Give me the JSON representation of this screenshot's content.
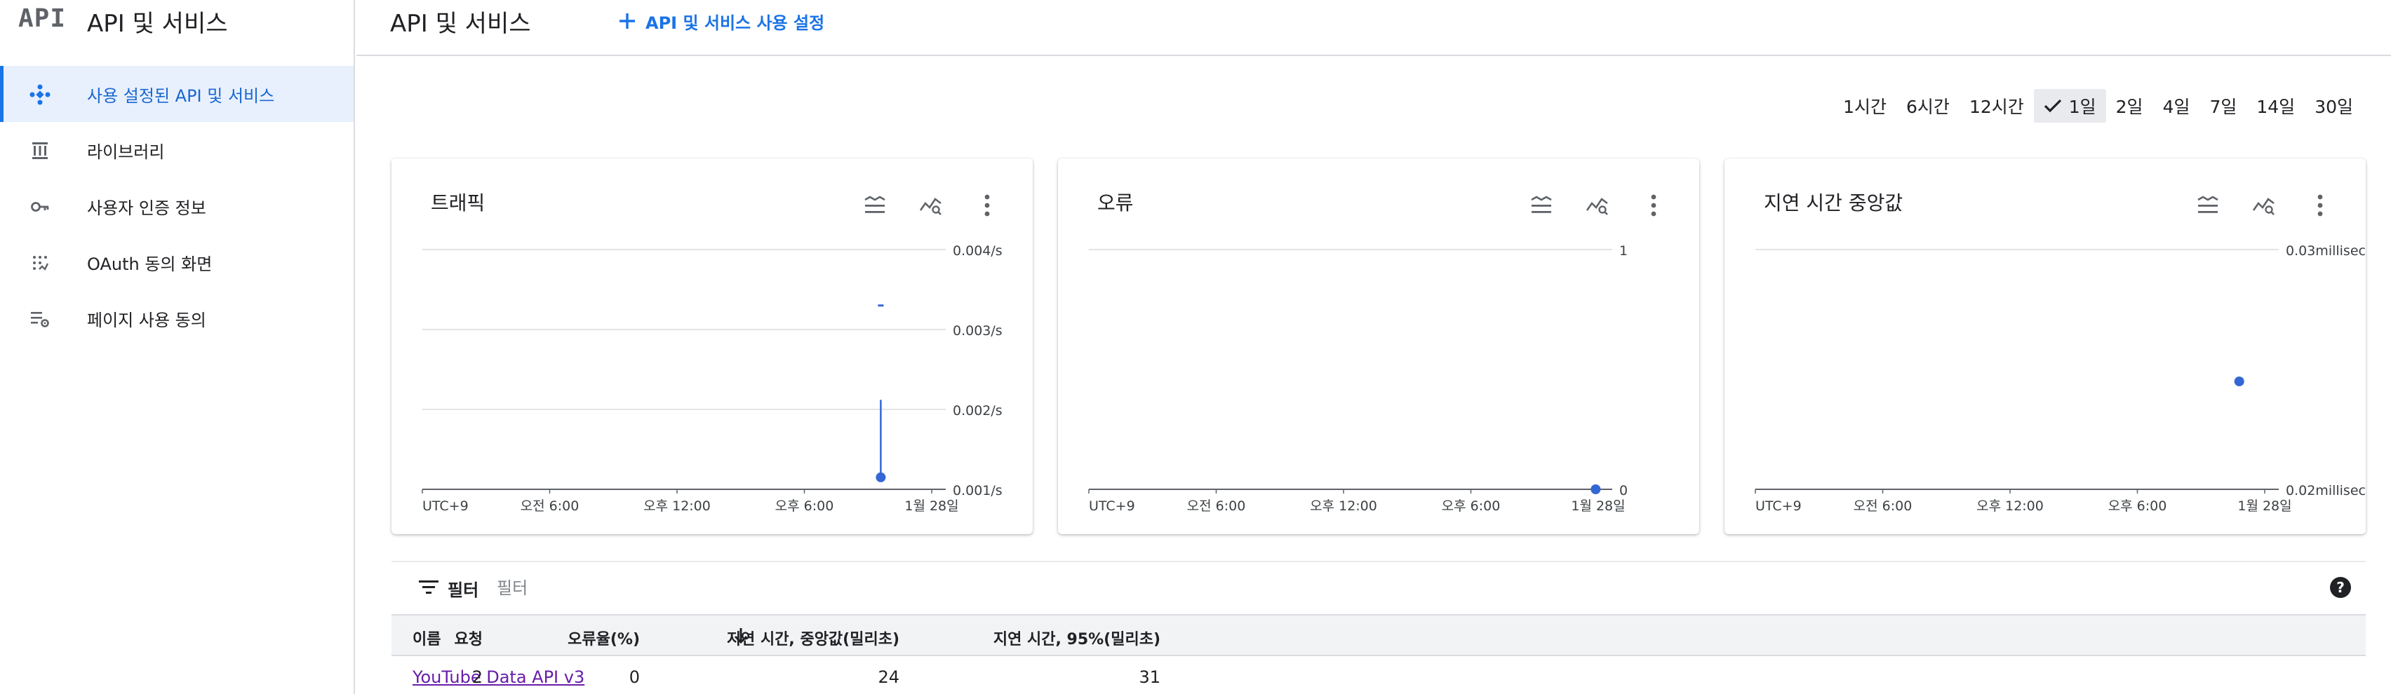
{
  "brand": {
    "logo": "API",
    "title": "API 및 서비스"
  },
  "sidebar": {
    "items": [
      {
        "label": "사용 설정된 API 및 서비스",
        "icon": "api-diamond-icon",
        "active": true
      },
      {
        "label": "라이브러리",
        "icon": "library-icon",
        "active": false
      },
      {
        "label": "사용자 인증 정보",
        "icon": "key-icon",
        "active": false
      },
      {
        "label": "OAuth 동의 화면",
        "icon": "oauth-consent-icon",
        "active": false
      },
      {
        "label": "페이지 사용 동의",
        "icon": "page-settings-icon",
        "active": false
      }
    ]
  },
  "header": {
    "title": "API 및 서비스",
    "enable_button": "API 및 서비스 사용 설정"
  },
  "time_range": {
    "options": [
      "1시간",
      "6시간",
      "12시간",
      "1일",
      "2일",
      "4일",
      "7일",
      "14일",
      "30일"
    ],
    "selected": "1일"
  },
  "colors": {
    "accent": "#1a73e8",
    "series": "#3367d6",
    "link": "#681da8",
    "active_bg": "#e8f0fe"
  },
  "chart_data": [
    {
      "type": "line",
      "title": "트래픽",
      "x_ticks": [
        "UTC+9",
        "오전 6:00",
        "오후 12:00",
        "오후 6:00",
        "1월 28일"
      ],
      "y_ticks": [
        "0.004/s",
        "0.003/s",
        "0.002/s",
        "0.001/s"
      ],
      "ylim": [
        0.001,
        0.004
      ],
      "points": [
        {
          "x": 0.9,
          "y": 0.0033
        },
        {
          "x": 0.9,
          "y": 0.00212
        },
        {
          "x": 0.9,
          "y": 0.00115
        }
      ],
      "marker_at_last": true
    },
    {
      "type": "scatter",
      "title": "오류",
      "x_ticks": [
        "UTC+9",
        "오전 6:00",
        "오후 12:00",
        "오후 6:00",
        "1월 28일"
      ],
      "y_ticks": [
        "1",
        "0"
      ],
      "ylim": [
        0,
        1
      ],
      "points": [
        {
          "x": 0.995,
          "y": 0
        }
      ],
      "marker_at_last": true
    },
    {
      "type": "scatter",
      "title": "지연 시간 중앙값",
      "x_ticks": [
        "UTC+9",
        "오전 6:00",
        "오후 12:00",
        "오후 6:00",
        "1월 28일"
      ],
      "y_ticks": [
        "0.03milliseconds",
        "0.02milliseconds"
      ],
      "ylim": [
        0.02,
        0.03
      ],
      "points": [
        {
          "x": 0.95,
          "y": 0.0245
        }
      ],
      "marker_at_last": true
    }
  ],
  "filter": {
    "label": "필터",
    "placeholder": "필터"
  },
  "table": {
    "columns": [
      "이름",
      "요청",
      "오류율(%)",
      "지연 시간, 중앙값(밀리초)",
      "지연 시간, 95%(밀리초)"
    ],
    "rows": [
      {
        "name": "YouTube Data API v3",
        "requests": "2",
        "error_rate": "0",
        "latency_median": "24",
        "latency_95": "31"
      }
    ]
  }
}
